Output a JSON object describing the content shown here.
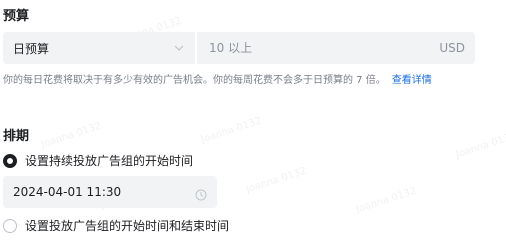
{
  "budget": {
    "title": "预算",
    "type_label": "日预算",
    "amount_placeholder": "10 以上",
    "currency": "USD",
    "hint_text": "你的每日花费将取决于有多少有效的广告机会。你的每周花费不会多于日预算的 7 倍。",
    "hint_link": "查看详情"
  },
  "schedule": {
    "title": "排期",
    "option_continuous": "设置持续投放广告组的开始时间",
    "start_datetime": "2024-04-01 11:30",
    "option_range": "设置投放广告组的开始时间和结束时间"
  },
  "watermark": "Joanna 0132",
  "icons": {
    "chevron": "chevron-down-icon",
    "clock": "clock-icon"
  }
}
